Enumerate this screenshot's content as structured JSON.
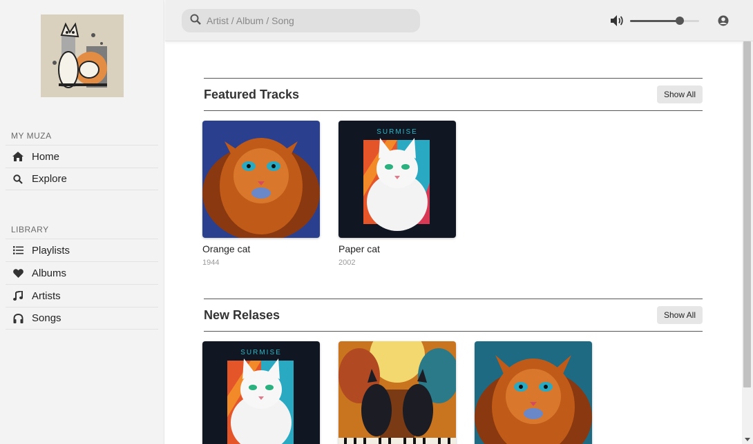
{
  "sidebar": {
    "sections": [
      {
        "title": "MY MUZA",
        "items": [
          {
            "label": "Home",
            "icon": "home-icon"
          },
          {
            "label": "Explore",
            "icon": "search-icon"
          }
        ]
      },
      {
        "title": "LIBRARY",
        "items": [
          {
            "label": "Playlists",
            "icon": "list-icon"
          },
          {
            "label": "Albums",
            "icon": "heart-icon"
          },
          {
            "label": "Artists",
            "icon": "music-note-icon"
          },
          {
            "label": "Songs",
            "icon": "headphones-icon"
          }
        ]
      }
    ]
  },
  "topbar": {
    "search_placeholder": "Artist / Album / Song",
    "volume_level": 0.72
  },
  "featured": {
    "title": "Featured Tracks",
    "show_all": "Show All",
    "tracks": [
      {
        "title": "Orange cat",
        "year": "1944"
      },
      {
        "title": "Paper cat",
        "year": "2002"
      }
    ]
  },
  "new_releases": {
    "title": "New Relases",
    "show_all": "Show All"
  },
  "album_art_text": "SURMISE",
  "colors": {
    "sidebar_bg": "#f3f3f3",
    "topbar_bg": "#efefef",
    "search_bg": "#e0e0e0"
  }
}
